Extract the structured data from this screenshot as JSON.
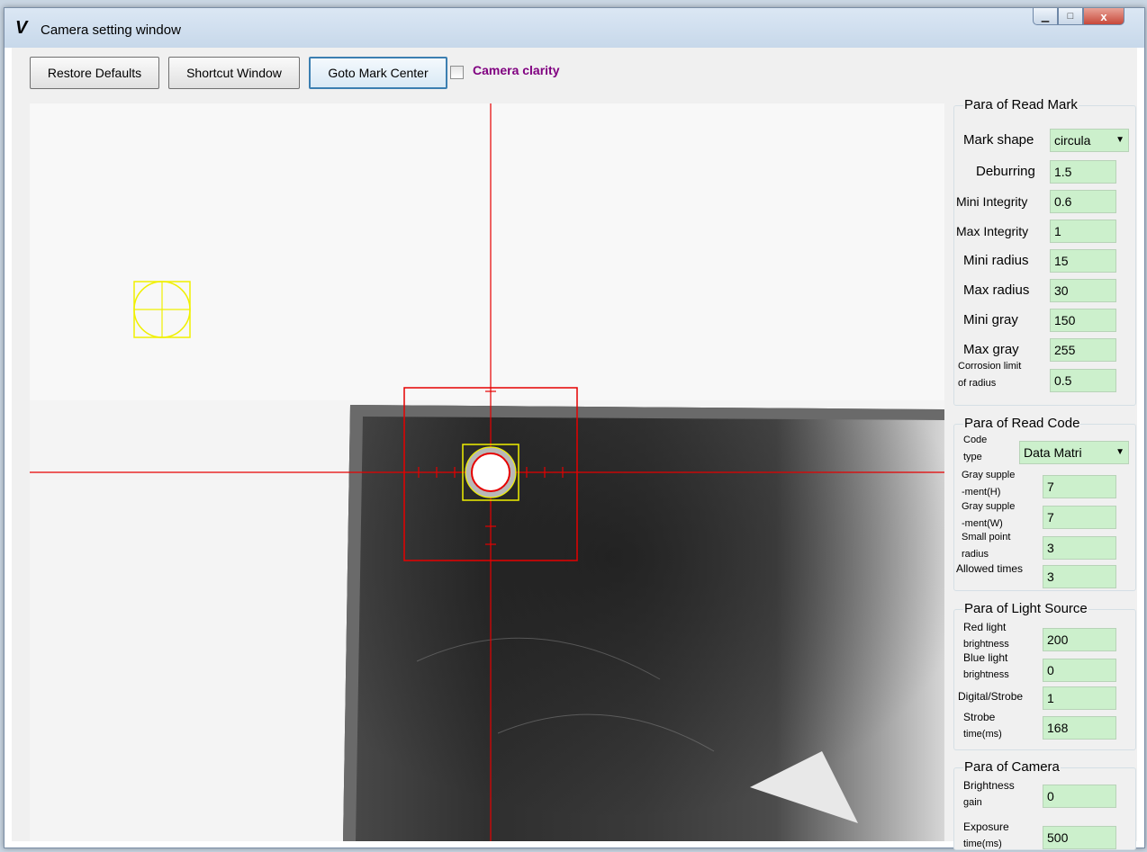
{
  "window": {
    "title": "Camera setting window",
    "icon": "v-logo-icon",
    "minimize_glyph": "▁",
    "maximize_glyph": "□",
    "close_glyph": "x"
  },
  "toolbar": {
    "restore_label": "Restore Defaults",
    "shortcut_label": "Shortcut Window",
    "goto_label": "Goto Mark Center",
    "clarity_label": "Camera clarity",
    "clarity_checked": false
  },
  "colors": {
    "crosshair": "#e60000",
    "mark_box": "#f0f000",
    "clarity": "#800080",
    "field_bg": "#ccf0cc"
  },
  "read_mark": {
    "title": "Para of Read Mark",
    "shape_label": "Mark shape",
    "shape_value": "circula",
    "deburring_label": "Deburring",
    "deburring_value": "1.5",
    "mini_integrity_label": "Mini Integrity",
    "mini_integrity_value": "0.6",
    "max_integrity_label": "Max Integrity",
    "max_integrity_value": "1",
    "mini_radius_label": "Mini radius",
    "mini_radius_value": "15",
    "max_radius_label": "Max radius",
    "max_radius_value": "30",
    "mini_gray_label": "Mini gray",
    "mini_gray_value": "150",
    "max_gray_label": "Max gray",
    "max_gray_value": "255",
    "corrosion_label_1": "Corrosion limit",
    "corrosion_label_2": "of radius",
    "corrosion_value": "0.5"
  },
  "read_code": {
    "title": "Para of Read Code",
    "type_label_1": "Code",
    "type_label_2": "type",
    "type_value": "Data Matri",
    "gray_h_label_1": "Gray supple",
    "gray_h_label_2": "-ment(H)",
    "gray_h_value": "7",
    "gray_w_label_1": "Gray supple",
    "gray_w_label_2": "-ment(W)",
    "gray_w_value": "7",
    "small_point_label_1": "Small point",
    "small_point_label_2": "radius",
    "small_point_value": "3",
    "allowed_label": "Allowed times",
    "allowed_value": "3"
  },
  "light": {
    "title": "Para of Light Source",
    "red_label_1": "Red light",
    "red_label_2": "brightness",
    "red_value": "200",
    "blue_label_1": "Blue light",
    "blue_label_2": "brightness",
    "blue_value": "0",
    "digital_label": "Digital/Strobe",
    "digital_value": "1",
    "strobe_label_1": "Strobe",
    "strobe_label_2": "time(ms)",
    "strobe_value": "168"
  },
  "camera": {
    "title": "Para of Camera",
    "gain_label_1": "Brightness",
    "gain_label_2": "gain",
    "gain_value": "0",
    "exposure_label_1": "Exposure",
    "exposure_label_2": "time(ms)",
    "exposure_value": "500"
  }
}
